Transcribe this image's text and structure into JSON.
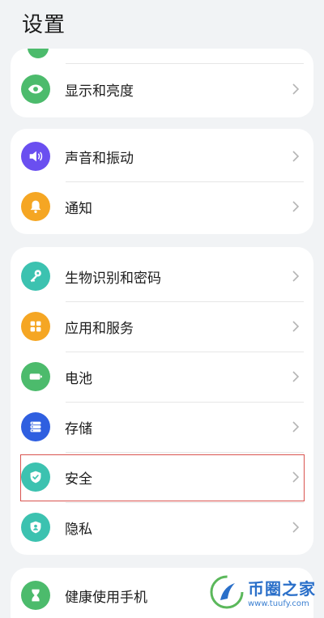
{
  "title": "设置",
  "colors": {
    "display": "#4cbb6c",
    "sound": "#6a4ff0",
    "notify": "#f5a623",
    "biometric": "#3cc2b0",
    "apps": "#f5a623",
    "battery": "#4cbb6c",
    "storage": "#2f5fe0",
    "security": "#3cc2b0",
    "privacy": "#3cc2b0",
    "health": "#4cbb6c",
    "highlight": "#d9534f"
  },
  "groups": [
    {
      "items": [
        {
          "label": "显示和亮度",
          "icon": "eye-icon"
        }
      ]
    },
    {
      "items": [
        {
          "label": "声音和振动",
          "icon": "speaker-icon"
        },
        {
          "label": "通知",
          "icon": "bell-icon"
        }
      ]
    },
    {
      "items": [
        {
          "label": "生物识别和密码",
          "icon": "key-icon"
        },
        {
          "label": "应用和服务",
          "icon": "apps-grid-icon"
        },
        {
          "label": "电池",
          "icon": "battery-icon"
        },
        {
          "label": "存储",
          "icon": "storage-icon"
        },
        {
          "label": "安全",
          "icon": "shield-check-icon"
        },
        {
          "label": "隐私",
          "icon": "privacy-shield-icon"
        }
      ]
    },
    {
      "items": [
        {
          "label": "健康使用手机",
          "icon": "hourglass-icon"
        }
      ]
    }
  ],
  "watermark": {
    "main": "币圈之家",
    "sub": "www.tuufy.com"
  }
}
